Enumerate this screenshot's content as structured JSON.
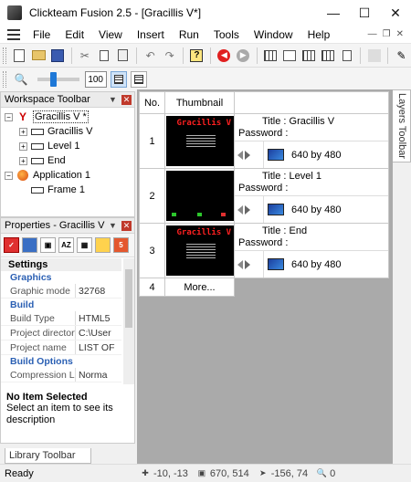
{
  "window": {
    "title": "Clickteam Fusion 2.5 - [Gracillis V*]"
  },
  "menu": {
    "items": [
      "File",
      "Edit",
      "View",
      "Insert",
      "Run",
      "Tools",
      "Window",
      "Help"
    ]
  },
  "zoom": {
    "value": "100"
  },
  "workspace": {
    "title": "Workspace Toolbar",
    "tree": [
      {
        "label": "Gracillis V *",
        "icon": "game-icon",
        "expander": "minus"
      },
      {
        "label": "Gracillis V",
        "icon": "frame-icon",
        "expander": "plus"
      },
      {
        "label": "Level 1",
        "icon": "frame-icon",
        "expander": "plus"
      },
      {
        "label": "End",
        "icon": "frame-icon",
        "expander": "plus"
      },
      {
        "label": "Application 1",
        "icon": "application-icon",
        "expander": "minus"
      },
      {
        "label": "Frame 1",
        "icon": "frame-icon",
        "expander": "none"
      }
    ]
  },
  "properties": {
    "title": "Properties - Gracillis V",
    "tabs": [
      "checklist-tab-icon",
      "display-tab-icon",
      "application-tab-icon",
      "az-tab-icon",
      "grid-tab-icon",
      "folder-tab-icon",
      "html5-tab-icon"
    ],
    "settings_label": "Settings",
    "categories": [
      {
        "name": "Graphics",
        "rows": [
          {
            "name": "Graphic mode",
            "value": "32768"
          }
        ]
      },
      {
        "name": "Build",
        "rows": [
          {
            "name": "Build Type",
            "value": "HTML5"
          },
          {
            "name": "Project directory",
            "value": "C:\\User"
          },
          {
            "name": "Project name",
            "value": "LIST OF"
          }
        ]
      },
      {
        "name": "Build Options",
        "rows": [
          {
            "name": "Compression Lev",
            "value": "Norma"
          }
        ]
      }
    ],
    "desc_title": "No Item Selected",
    "desc_text": "Select an item to see its description"
  },
  "library_tab": "Library Toolbar",
  "layers_tab": "Layers Toolbar",
  "storyboard": {
    "col_no": "No.",
    "col_thumb": "Thumbnail",
    "frames": [
      {
        "no": "1",
        "title": "Title : Gracillis V",
        "password": "Password :",
        "w": "640",
        "by": "by",
        "h": "480",
        "thumb": "title-screen"
      },
      {
        "no": "2",
        "title": "Title : Level 1",
        "password": "Password :",
        "w": "640",
        "by": "by",
        "h": "480",
        "thumb": "level"
      },
      {
        "no": "3",
        "title": "Title : End",
        "password": "Password :",
        "w": "640",
        "by": "by",
        "h": "480",
        "thumb": "title-screen"
      }
    ],
    "more_row": {
      "no": "4",
      "label": "More..."
    }
  },
  "status": {
    "ready": "Ready",
    "coords1": "-10, -13",
    "size": "670, 514",
    "coords2": "-156, 74",
    "zoom_state": "0"
  },
  "colors": {
    "accent": "#1e78d7",
    "category_text": "#2a5fb3",
    "close_red": "#c0392b"
  }
}
